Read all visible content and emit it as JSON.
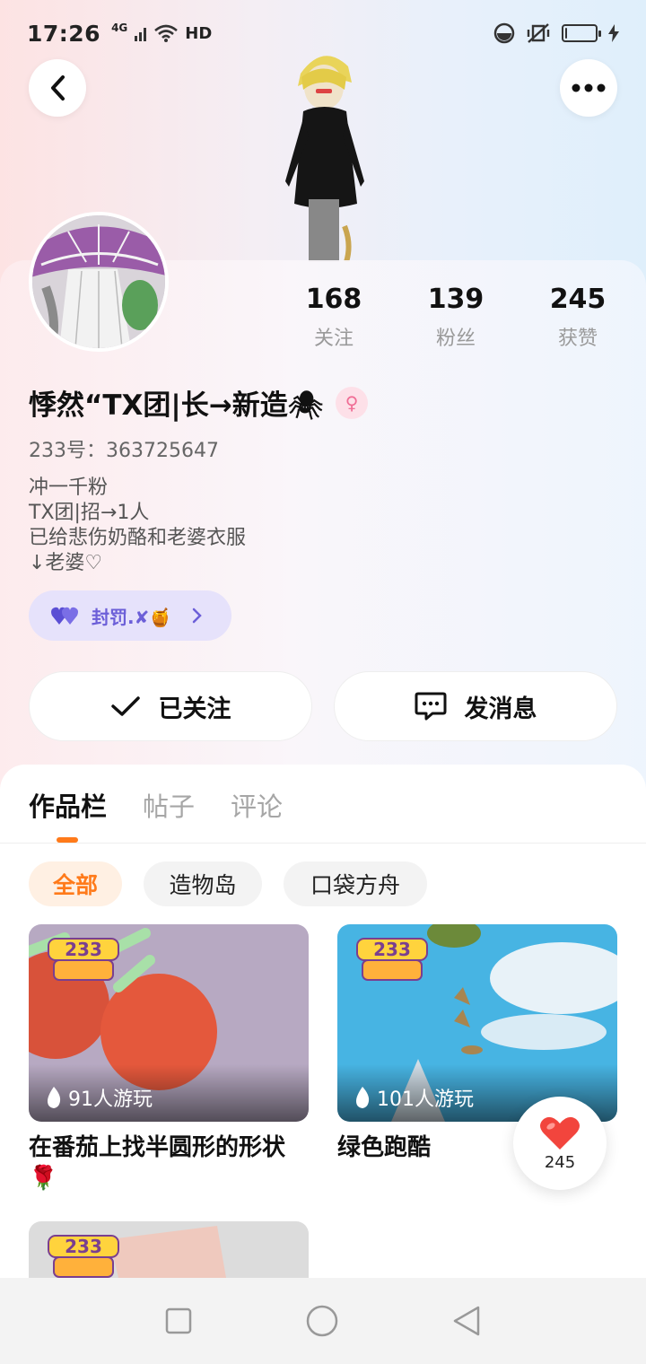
{
  "status_bar": {
    "time": "17:26",
    "network_label": "4G",
    "hd_label": "HD",
    "battery_level": 0.05
  },
  "icons": {
    "back": "chevron-left-icon",
    "more": "more-horizontal-icon",
    "heart": "heart-icon",
    "check": "check-icon",
    "message": "chat-bubble-icon",
    "flame": "flame-icon"
  },
  "profile": {
    "stats": [
      {
        "value": "168",
        "label": "关注"
      },
      {
        "value": "139",
        "label": "粉丝"
      },
      {
        "value": "245",
        "label": "获赞"
      }
    ],
    "username": "悸然“TX团|长→新造🕷",
    "gender_symbol": "♀",
    "user_id": "233号：363725647",
    "bio_lines": [
      "冲一千粉",
      "TX团|招→1人",
      "已给悲伤奶酪和老婆衣服",
      "↓老婆♡"
    ],
    "honor": "封罚.✘🍯"
  },
  "actions": {
    "follow_label": "已关注",
    "message_label": "发消息"
  },
  "tabs": [
    {
      "label": "作品栏",
      "active": true
    },
    {
      "label": "帖子",
      "active": false
    },
    {
      "label": "评论",
      "active": false
    }
  ],
  "filters": [
    {
      "label": "全部",
      "active": true
    },
    {
      "label": "造物岛",
      "active": false
    },
    {
      "label": "口袋方舟",
      "active": false
    }
  ],
  "works": [
    {
      "title": "在番茄上找半圆形的形状🌹",
      "plays": "91人游玩",
      "badge": "233造物岛"
    },
    {
      "title": "绿色跑酷",
      "plays": "101人游玩",
      "badge": "233造物岛"
    },
    {
      "title": "",
      "plays": "",
      "badge": "233造物岛"
    }
  ],
  "like_fab": {
    "count": "245"
  },
  "colors": {
    "accent": "#ff7a1a",
    "honor": "#6c5fd8",
    "gender": "#f06d95"
  }
}
